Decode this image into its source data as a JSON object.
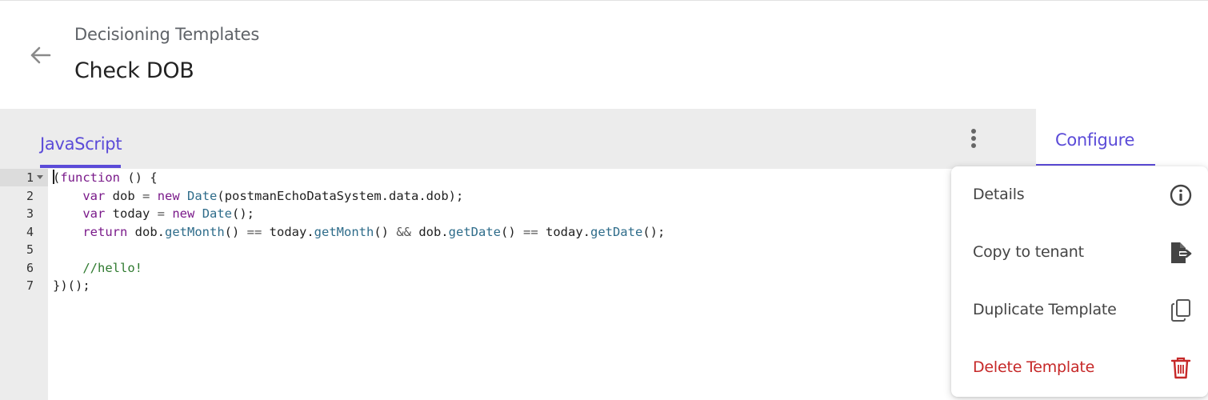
{
  "header": {
    "breadcrumb": "Decisioning Templates",
    "title": "Check DOB"
  },
  "editor": {
    "tab_label": "JavaScript",
    "line_numbers": [
      "1",
      "2",
      "3",
      "4",
      "5",
      "6",
      "7"
    ]
  },
  "sidebar": {
    "tab_label": "Configure"
  },
  "menu": {
    "items": [
      {
        "label": "Details",
        "icon": "info-icon"
      },
      {
        "label": "Copy to tenant",
        "icon": "file-export-icon"
      },
      {
        "label": "Duplicate Template",
        "icon": "copy-icon"
      },
      {
        "label": "Delete Template",
        "icon": "trash-icon"
      }
    ]
  },
  "colors": {
    "accent": "#5b4bd8",
    "danger": "#c62828",
    "panel_bg": "#ececec"
  }
}
